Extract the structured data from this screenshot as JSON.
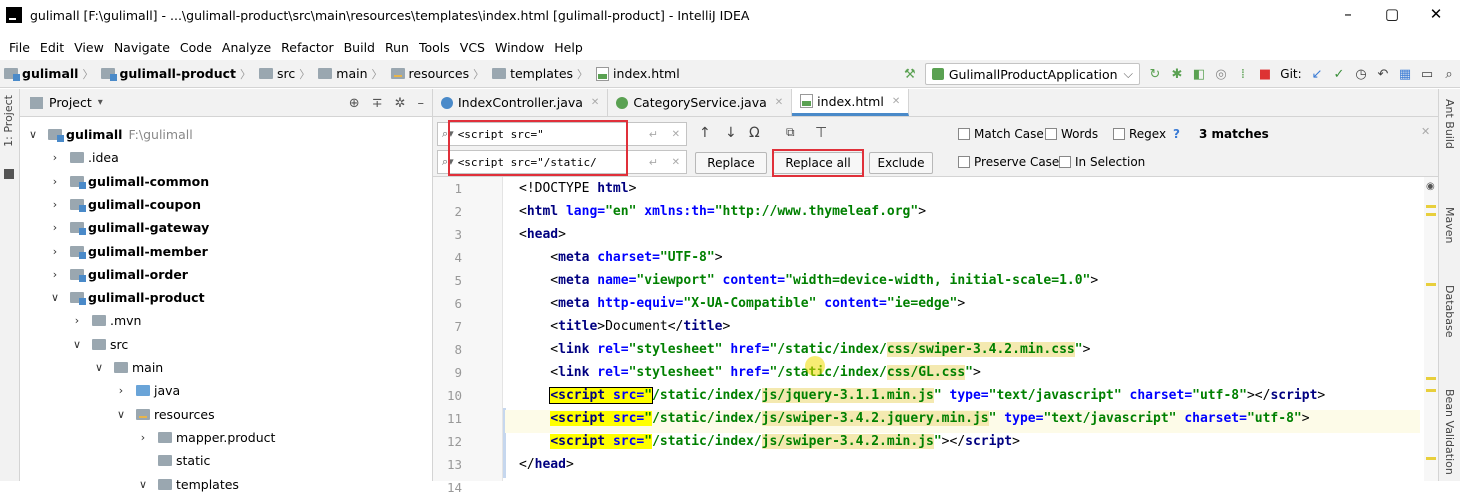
{
  "window": {
    "title": "gulimall [F:\\gulimall] - ...\\gulimall-product\\src\\main\\resources\\templates\\index.html [gulimall-product] - IntelliJ IDEA",
    "minimize": "–",
    "maximize": "▢",
    "close": "✕"
  },
  "menu": [
    "File",
    "Edit",
    "View",
    "Navigate",
    "Code",
    "Analyze",
    "Refactor",
    "Build",
    "Run",
    "Tools",
    "VCS",
    "Window",
    "Help"
  ],
  "breadcrumbs": [
    "gulimall",
    "gulimall-product",
    "src",
    "main",
    "resources",
    "templates",
    "index.html"
  ],
  "toolbar": {
    "run_config": "GulimallProductApplication",
    "git_label": "Git:"
  },
  "project_panel": {
    "title": "Project",
    "side_label": "1: Project",
    "tree": [
      {
        "label": "gulimall",
        "hint": "F:\\gulimall",
        "expanded": true,
        "level": 0,
        "bold": true
      },
      {
        "label": ".idea",
        "expanded": false,
        "level": 1,
        "bold": false
      },
      {
        "label": "gulimall-common",
        "expanded": false,
        "level": 1,
        "bold": true
      },
      {
        "label": "gulimall-coupon",
        "expanded": false,
        "level": 1,
        "bold": true
      },
      {
        "label": "gulimall-gateway",
        "expanded": false,
        "level": 1,
        "bold": true
      },
      {
        "label": "gulimall-member",
        "expanded": false,
        "level": 1,
        "bold": true
      },
      {
        "label": "gulimall-order",
        "expanded": false,
        "level": 1,
        "bold": true
      },
      {
        "label": "gulimall-product",
        "expanded": true,
        "level": 1,
        "bold": true
      },
      {
        "label": ".mvn",
        "expanded": false,
        "level": 2,
        "bold": false
      },
      {
        "label": "src",
        "expanded": true,
        "level": 2,
        "bold": false
      },
      {
        "label": "main",
        "expanded": true,
        "level": 3,
        "bold": false
      },
      {
        "label": "java",
        "expanded": false,
        "level": 4,
        "bold": false
      },
      {
        "label": "resources",
        "expanded": true,
        "level": 4,
        "bold": false
      },
      {
        "label": "mapper.product",
        "expanded": false,
        "level": 5,
        "bold": false
      },
      {
        "label": "static",
        "expanded": null,
        "level": 5,
        "bold": false
      },
      {
        "label": "templates",
        "expanded": true,
        "level": 5,
        "bold": false
      }
    ]
  },
  "tabs": [
    {
      "label": "IndexController.java",
      "active": false
    },
    {
      "label": "CategoryService.java",
      "active": false
    },
    {
      "label": "index.html",
      "active": true
    }
  ],
  "find": {
    "search_value": "<script src=\"",
    "replace_value": "<script src=\"/static/",
    "replace_label": "Replace",
    "replace_all_label": "Replace all",
    "exclude_label": "Exclude",
    "match_case": "Match Case",
    "words": "Words",
    "regex": "Regex",
    "regex_help": "?",
    "preserve_case": "Preserve Case",
    "in_selection": "In Selection",
    "match_count": "3 matches"
  },
  "right_strip": [
    "Ant Build",
    "Maven",
    "Database",
    "Bean Validation"
  ],
  "code_lines": [
    "1",
    "2",
    "3",
    "4",
    "5",
    "6",
    "7",
    "8",
    "9",
    "10",
    "11",
    "12",
    "13",
    "14"
  ]
}
